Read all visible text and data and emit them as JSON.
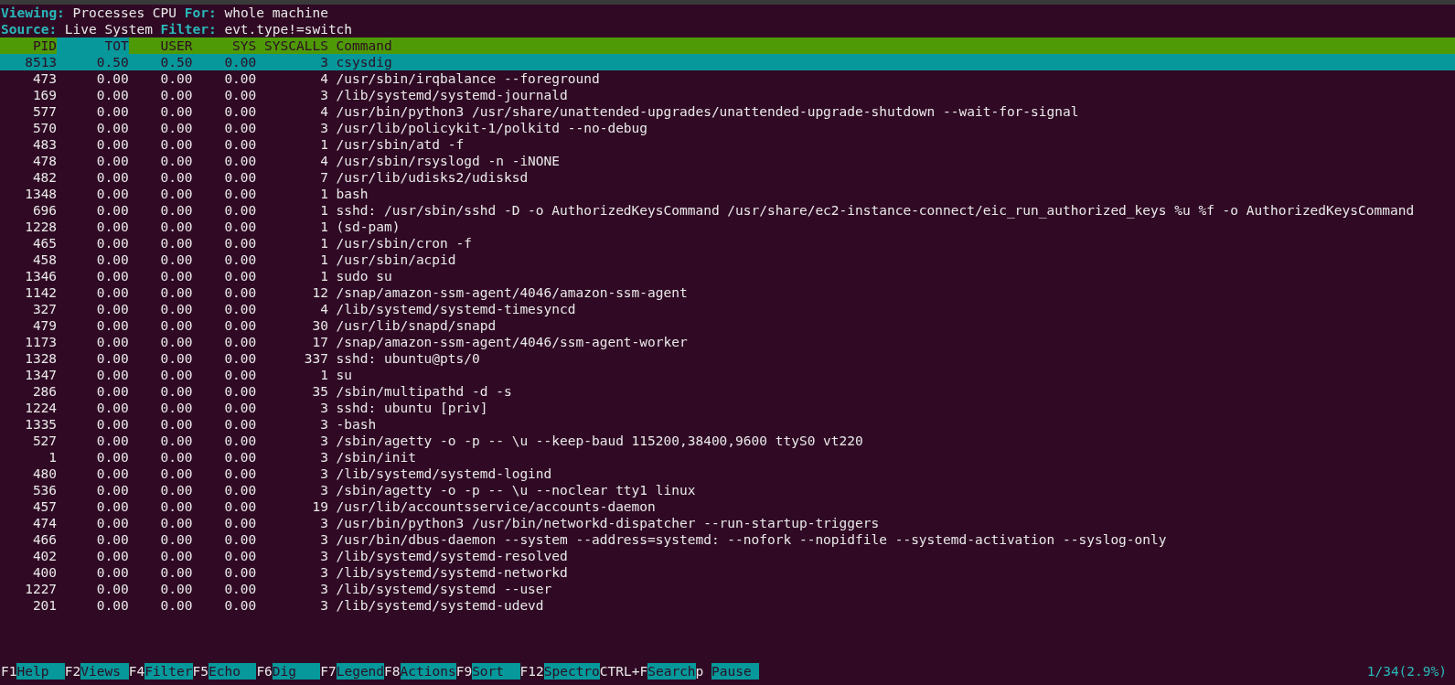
{
  "info_lines": [
    {
      "parts": [
        {
          "label": "Viewing:",
          "value": "Processes CPU"
        },
        {
          "label": "For:",
          "value": "whole machine"
        }
      ]
    },
    {
      "parts": [
        {
          "label": "Source:",
          "value": "Live System"
        },
        {
          "label": "Filter:",
          "value": "evt.type!=switch"
        }
      ]
    }
  ],
  "table": {
    "columns": [
      {
        "label": "PID",
        "selected": false
      },
      {
        "label": "TOT",
        "selected": true
      },
      {
        "label": "USER",
        "selected": false
      },
      {
        "label": "SYS",
        "selected": false
      },
      {
        "label": "SYSCALLS",
        "selected": false
      },
      {
        "label": "Command",
        "selected": false
      }
    ],
    "rows": [
      {
        "pid": "8513",
        "tot": "0.50",
        "user": "0.50",
        "sys": "0.00",
        "syscalls": "3",
        "command": "csysdig",
        "selected": true
      },
      {
        "pid": "473",
        "tot": "0.00",
        "user": "0.00",
        "sys": "0.00",
        "syscalls": "4",
        "command": "/usr/sbin/irqbalance --foreground",
        "selected": false
      },
      {
        "pid": "169",
        "tot": "0.00",
        "user": "0.00",
        "sys": "0.00",
        "syscalls": "3",
        "command": "/lib/systemd/systemd-journald",
        "selected": false
      },
      {
        "pid": "577",
        "tot": "0.00",
        "user": "0.00",
        "sys": "0.00",
        "syscalls": "4",
        "command": "/usr/bin/python3 /usr/share/unattended-upgrades/unattended-upgrade-shutdown --wait-for-signal",
        "selected": false
      },
      {
        "pid": "570",
        "tot": "0.00",
        "user": "0.00",
        "sys": "0.00",
        "syscalls": "3",
        "command": "/usr/lib/policykit-1/polkitd --no-debug",
        "selected": false
      },
      {
        "pid": "483",
        "tot": "0.00",
        "user": "0.00",
        "sys": "0.00",
        "syscalls": "1",
        "command": "/usr/sbin/atd -f",
        "selected": false
      },
      {
        "pid": "478",
        "tot": "0.00",
        "user": "0.00",
        "sys": "0.00",
        "syscalls": "4",
        "command": "/usr/sbin/rsyslogd -n -iNONE",
        "selected": false
      },
      {
        "pid": "482",
        "tot": "0.00",
        "user": "0.00",
        "sys": "0.00",
        "syscalls": "7",
        "command": "/usr/lib/udisks2/udisksd",
        "selected": false
      },
      {
        "pid": "1348",
        "tot": "0.00",
        "user": "0.00",
        "sys": "0.00",
        "syscalls": "1",
        "command": "bash",
        "selected": false
      },
      {
        "pid": "696",
        "tot": "0.00",
        "user": "0.00",
        "sys": "0.00",
        "syscalls": "1",
        "command": "sshd: /usr/sbin/sshd -D -o AuthorizedKeysCommand /usr/share/ec2-instance-connect/eic_run_authorized_keys %u %f -o AuthorizedKeysCommand",
        "selected": false
      },
      {
        "pid": "1228",
        "tot": "0.00",
        "user": "0.00",
        "sys": "0.00",
        "syscalls": "1",
        "command": "(sd-pam)",
        "selected": false
      },
      {
        "pid": "465",
        "tot": "0.00",
        "user": "0.00",
        "sys": "0.00",
        "syscalls": "1",
        "command": "/usr/sbin/cron -f",
        "selected": false
      },
      {
        "pid": "458",
        "tot": "0.00",
        "user": "0.00",
        "sys": "0.00",
        "syscalls": "1",
        "command": "/usr/sbin/acpid",
        "selected": false
      },
      {
        "pid": "1346",
        "tot": "0.00",
        "user": "0.00",
        "sys": "0.00",
        "syscalls": "1",
        "command": "sudo su",
        "selected": false
      },
      {
        "pid": "1142",
        "tot": "0.00",
        "user": "0.00",
        "sys": "0.00",
        "syscalls": "12",
        "command": "/snap/amazon-ssm-agent/4046/amazon-ssm-agent",
        "selected": false
      },
      {
        "pid": "327",
        "tot": "0.00",
        "user": "0.00",
        "sys": "0.00",
        "syscalls": "4",
        "command": "/lib/systemd/systemd-timesyncd",
        "selected": false
      },
      {
        "pid": "479",
        "tot": "0.00",
        "user": "0.00",
        "sys": "0.00",
        "syscalls": "30",
        "command": "/usr/lib/snapd/snapd",
        "selected": false
      },
      {
        "pid": "1173",
        "tot": "0.00",
        "user": "0.00",
        "sys": "0.00",
        "syscalls": "17",
        "command": "/snap/amazon-ssm-agent/4046/ssm-agent-worker",
        "selected": false
      },
      {
        "pid": "1328",
        "tot": "0.00",
        "user": "0.00",
        "sys": "0.00",
        "syscalls": "337",
        "command": "sshd: ubuntu@pts/0",
        "selected": false
      },
      {
        "pid": "1347",
        "tot": "0.00",
        "user": "0.00",
        "sys": "0.00",
        "syscalls": "1",
        "command": "su",
        "selected": false
      },
      {
        "pid": "286",
        "tot": "0.00",
        "user": "0.00",
        "sys": "0.00",
        "syscalls": "35",
        "command": "/sbin/multipathd -d -s",
        "selected": false
      },
      {
        "pid": "1224",
        "tot": "0.00",
        "user": "0.00",
        "sys": "0.00",
        "syscalls": "3",
        "command": "sshd: ubuntu [priv]",
        "selected": false
      },
      {
        "pid": "1335",
        "tot": "0.00",
        "user": "0.00",
        "sys": "0.00",
        "syscalls": "3",
        "command": "-bash",
        "selected": false
      },
      {
        "pid": "527",
        "tot": "0.00",
        "user": "0.00",
        "sys": "0.00",
        "syscalls": "3",
        "command": "/sbin/agetty -o -p -- \\u --keep-baud 115200,38400,9600 ttyS0 vt220",
        "selected": false
      },
      {
        "pid": "1",
        "tot": "0.00",
        "user": "0.00",
        "sys": "0.00",
        "syscalls": "3",
        "command": "/sbin/init",
        "selected": false
      },
      {
        "pid": "480",
        "tot": "0.00",
        "user": "0.00",
        "sys": "0.00",
        "syscalls": "3",
        "command": "/lib/systemd/systemd-logind",
        "selected": false
      },
      {
        "pid": "536",
        "tot": "0.00",
        "user": "0.00",
        "sys": "0.00",
        "syscalls": "3",
        "command": "/sbin/agetty -o -p -- \\u --noclear tty1 linux",
        "selected": false
      },
      {
        "pid": "457",
        "tot": "0.00",
        "user": "0.00",
        "sys": "0.00",
        "syscalls": "19",
        "command": "/usr/lib/accountsservice/accounts-daemon",
        "selected": false
      },
      {
        "pid": "474",
        "tot": "0.00",
        "user": "0.00",
        "sys": "0.00",
        "syscalls": "3",
        "command": "/usr/bin/python3 /usr/bin/networkd-dispatcher --run-startup-triggers",
        "selected": false
      },
      {
        "pid": "466",
        "tot": "0.00",
        "user": "0.00",
        "sys": "0.00",
        "syscalls": "3",
        "command": "/usr/bin/dbus-daemon --system --address=systemd: --nofork --nopidfile --systemd-activation --syslog-only",
        "selected": false
      },
      {
        "pid": "402",
        "tot": "0.00",
        "user": "0.00",
        "sys": "0.00",
        "syscalls": "3",
        "command": "/lib/systemd/systemd-resolved",
        "selected": false
      },
      {
        "pid": "400",
        "tot": "0.00",
        "user": "0.00",
        "sys": "0.00",
        "syscalls": "3",
        "command": "/lib/systemd/systemd-networkd",
        "selected": false
      },
      {
        "pid": "1227",
        "tot": "0.00",
        "user": "0.00",
        "sys": "0.00",
        "syscalls": "3",
        "command": "/lib/systemd/systemd --user",
        "selected": false
      },
      {
        "pid": "201",
        "tot": "0.00",
        "user": "0.00",
        "sys": "0.00",
        "syscalls": "3",
        "command": "/lib/systemd/systemd-udevd",
        "selected": false
      }
    ]
  },
  "function_keys": [
    {
      "key": "F1",
      "label": "Help"
    },
    {
      "key": "F2",
      "label": "Views"
    },
    {
      "key": "F4",
      "label": "Filter"
    },
    {
      "key": "F5",
      "label": "Echo"
    },
    {
      "key": "F6",
      "label": "Dig"
    },
    {
      "key": "F7",
      "label": "Legend"
    },
    {
      "key": "F8",
      "label": "Actions"
    },
    {
      "key": "F9",
      "label": "Sort"
    },
    {
      "key": "F12",
      "label": "Spectro"
    },
    {
      "key": "CTRL+F",
      "label": "Search"
    },
    {
      "key": "p",
      "label": "Pause"
    }
  ],
  "status": "1/34(2.9%)"
}
